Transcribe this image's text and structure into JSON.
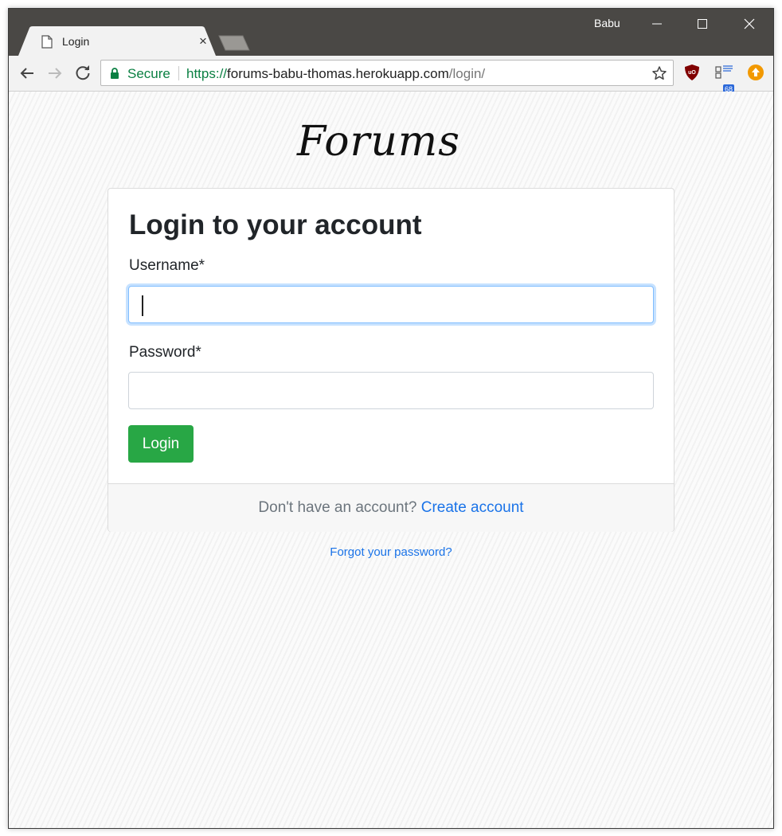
{
  "browser": {
    "profile_name": "Babu",
    "tab": {
      "title": "Login",
      "close": "×"
    },
    "omnibox": {
      "secure_label": "Secure",
      "url_scheme": "https://",
      "url_host": "forums-babu-thomas.herokuapp.com",
      "url_path": "/login/"
    },
    "extensions": [
      {
        "icon": "ublock-shield-icon",
        "label": "uO"
      },
      {
        "icon": "extension-badge-icon",
        "badge": "68"
      },
      {
        "icon": "upload-arrow-icon"
      }
    ]
  },
  "page": {
    "logo_text": "Forums",
    "card": {
      "title": "Login to your account",
      "username_label": "Username*",
      "username_value": "",
      "password_label": "Password*",
      "password_value": "",
      "submit_label": "Login",
      "footer_text": "Don't have an account?",
      "footer_link": "Create account"
    },
    "forgot_link": "Forgot your password?"
  },
  "colors": {
    "titlebar": "#4a4845",
    "secure_green": "#0b8043",
    "primary_button": "#28a745",
    "link_blue": "#1a73e8",
    "focus_border": "#80bdff"
  }
}
